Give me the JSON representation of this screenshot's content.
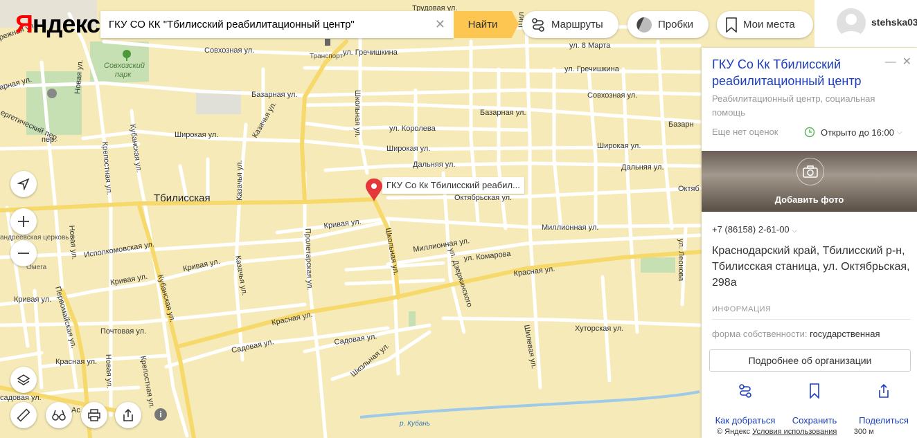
{
  "logo": {
    "first": "Я",
    "rest": "ндекс"
  },
  "search": {
    "value": "ГКУ СО КК \"Тбилисский реабилитационный центр\"",
    "find_label": "Найти"
  },
  "header": {
    "routes_label": "Маршруты",
    "traffic_label": "Пробки",
    "places_label": "Мои места",
    "username": "stehska03"
  },
  "map": {
    "town_label": "Тбилисская",
    "pin_label": "ГКУ Со Кк Тбилисский реабил...",
    "streets": {
      "trudovaya": "Трудовая ул.",
      "sovhoznaya1": "Совхозная ул.",
      "grechishkina1": "ул. Гречишкина",
      "vos8marta": "ул. 8 Марта",
      "grechishkina2": "ул. Гречишкина",
      "bazarnaya1": "Базарная ул.",
      "sovhoznaya2": "Совхозная ул.",
      "bazarnaya2": "Базарная ул.",
      "bazarnaya3": "Базарн",
      "korolyova": "ул. Королева",
      "shirokaya1": "Широкая ул.",
      "shirokaya2": "Широкая ул.",
      "shirokaya3": "Широкая ул.",
      "dalnyaya1": "Дальняя ул.",
      "dalnyaya2": "Дальняя ул.",
      "oktyabrskaya1": "Октябрьская ул.",
      "oktyabrskaya2": "Октяб",
      "krivaya1": "Кривая ул.",
      "millionnaya1": "Миллионная ул.",
      "millionnaya2": "Миллионная ул.",
      "komarova": "ул. Комарова",
      "ispolkomovskaya": "Исполкомовская ул.",
      "krivaya2": "Кривая ул.",
      "krivaya3": "Кривая ул.",
      "krivaya4": "Кривая ул.",
      "krasnaya1": "Красная ул.",
      "krasnaya2": "Красная ул.",
      "krasnaya3": "Красная ул.",
      "pochtovaya": "Почтовая ул.",
      "sadovaya1": "Садовая ул.",
      "sadovaya2": "Садовая ул.",
      "sadovaya3": "Садовая ул.",
      "khutorskaya": "Хуторская ул.",
      "shkolnaya1": "Школьная ул.",
      "shkolnaya2": "Школьная ул.",
      "shkolnaya3": "Школьная ул.",
      "proletarskaya": "Пролетарская ул.",
      "kazachya1": "Казачья ул.",
      "kazachya2": "Казачья ул.",
      "kazachya3": "Казачья ул.",
      "kubanskaya1": "Кубанская ул.",
      "kubanskaya2": "Кубанская ул.",
      "krepostnaya1": "Крепостная ул.",
      "krepostnaya2": "Крепостная ул.",
      "novaya1": "Новая ул.",
      "novaya2": "Новая ул.",
      "novaya3": "Новая ул.",
      "pervomayskaya": "Первомайская ул.",
      "dzerzhinskogo": "ул. Дзержинского",
      "shilevaya": "Шилевая ул.",
      "shilevaya2": "Шил",
      "leonova": "ул. Леонова",
      "energetichesky": "ергетический пер.",
      "zharnaya": "режная ул.",
      "bazarnaya_w": "арная ул.",
      "krasnaya_w": "Красная ул.",
      "sadovaya_w": "садовая ул.",
      "astr": "Ас",
      "per": "пер."
    },
    "pois": {
      "park": "Совхозский парк",
      "transport": "Транспорт",
      "church": "андреевская церковь",
      "omega": "Омега",
      "river": "р. Кубань"
    }
  },
  "panel": {
    "title": "ГКУ Со Кк Тбилисский реабилитационный центр",
    "category": "Реабилитационный центр, социальная помощь",
    "rating": "Еще нет оценок",
    "hours": "Открыто до 16:00",
    "add_photo": "Добавить фото",
    "phone": "+7 (86158) 2-61-00",
    "address": "Краснодарский край, Тбилисский р-н, Тбилисская станица, ул. Октябрьская, 298а",
    "info_heading": "ИНФОРМАЦИЯ",
    "ownership_label": "форма собственности:",
    "ownership_value": "государственная",
    "more_button": "Подробнее об организации",
    "actions": {
      "route": "Как добраться",
      "save": "Сохранить",
      "share": "Поделиться"
    }
  },
  "footer": {
    "copyright": "© Яндекс",
    "terms": "Условия использования",
    "scale": "300 м"
  },
  "colors": {
    "map_bg": "#f5eab8",
    "road": "#ffffff",
    "main_road": "#f7d96b",
    "accent_yellow": "#fdc650",
    "link_blue": "#1a3dc1",
    "pin_red": "#e5363b",
    "park_green": "#c6e0b4"
  }
}
